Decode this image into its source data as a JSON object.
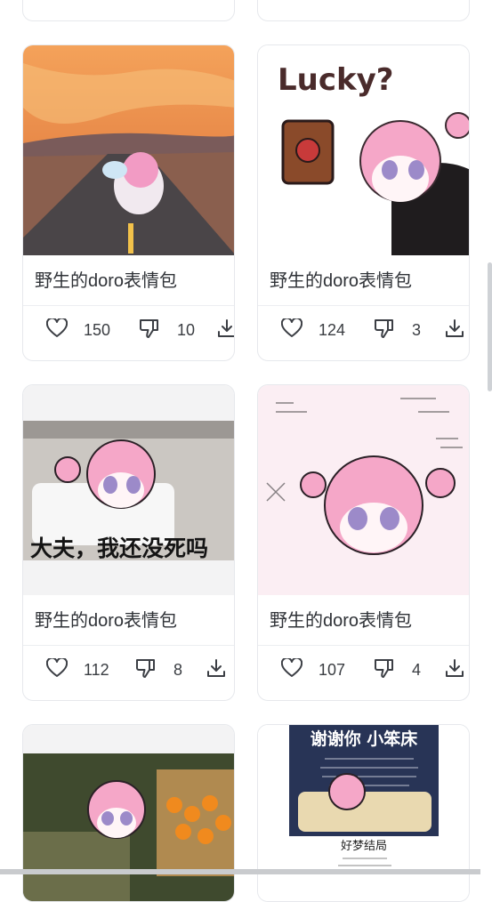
{
  "cards": [
    {
      "title": "野生的doro表情包",
      "likes": "150",
      "dislikes": "10",
      "image": "doro-sunset-road"
    },
    {
      "title": "野生的doro表情包",
      "likes": "124",
      "dislikes": "3",
      "image": "doro-lucky-coffee"
    },
    {
      "title": "野生的doro表情包",
      "likes": "112",
      "dislikes": "8",
      "image": "doro-hospital-bed"
    },
    {
      "title": "野生的doro表情包",
      "likes": "107",
      "dislikes": "4",
      "image": "doro-thinking-math"
    }
  ],
  "image_texts": {
    "lucky": "Lucky?",
    "hospital_caption": "大夫，我还没死吗",
    "thanks_title": "谢谢你 小笨床",
    "good_dream": "好梦结局"
  },
  "icons": {
    "like": "heart-outline-icon",
    "dislike": "thumbs-down-icon",
    "download": "download-icon"
  }
}
